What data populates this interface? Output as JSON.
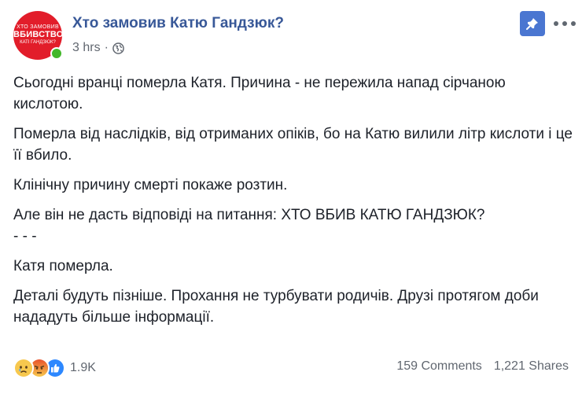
{
  "post": {
    "page_name": "Хто замовив Катю Гандзюк?",
    "time": "3 hrs",
    "separator": "·",
    "avatar": {
      "line1": "ХТО ЗАМОВИВ",
      "line2": "ВБИВСТВО",
      "line3": "КАТІ ГАНДЗЮК?",
      "bg_color": "#e21d2a"
    },
    "paragraphs": [
      "Сьогодні вранці померла Катя. Причина - не пережила напад сірчаною кислотою.",
      "Померла від наслідків, від отриманих опіків, бо на Катю вилили літр кислоти і це її вбило.",
      "Клінічну причину смерті покаже розтин.",
      "Але він не дасть відповіді на питання: ХТО ВБИВ КАТЮ ГАНДЗЮК?",
      "- - -",
      "Катя померла.",
      "Деталі будуть пізніше. Прохання не турбувати родичів. Друзі протягом доби нададуть більше інформації."
    ],
    "reactions": {
      "icons": [
        "sad-reaction-icon",
        "angry-reaction-icon",
        "like-reaction-icon"
      ],
      "count": "1.9K"
    },
    "comments": "159 Comments",
    "shares": "1,221 Shares",
    "colors": {
      "link": "#385898",
      "meta": "#616770",
      "pin_button": "#4a76d1",
      "online": "#42b72a"
    }
  }
}
